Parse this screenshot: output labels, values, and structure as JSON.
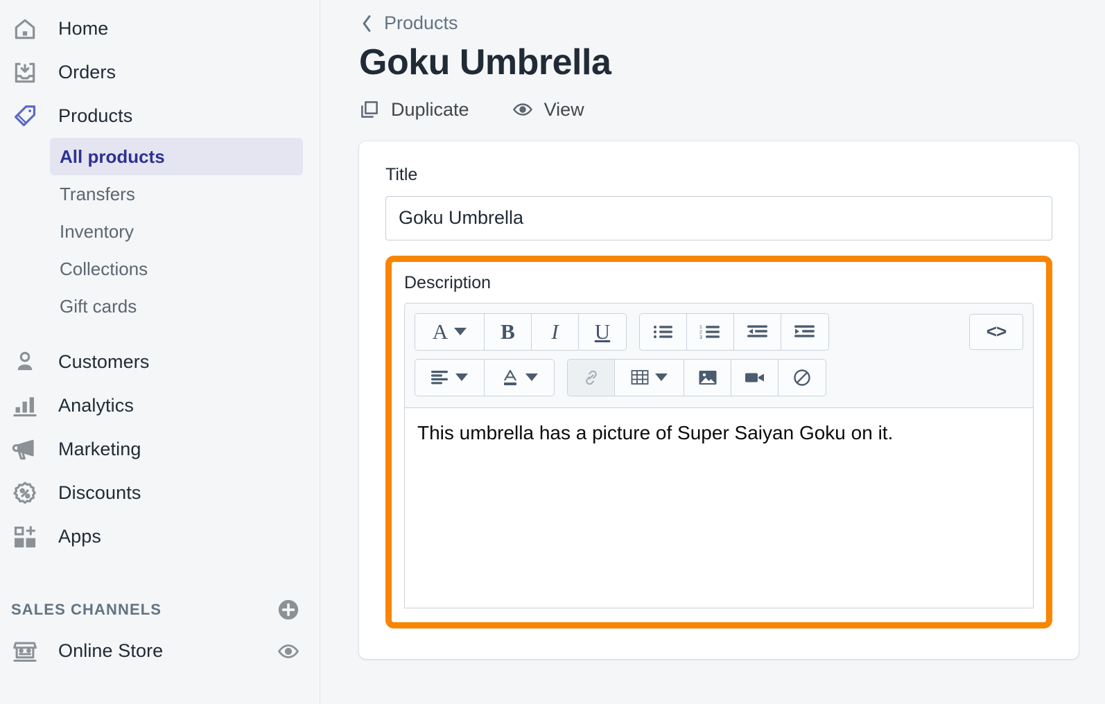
{
  "sidebar": {
    "items": [
      {
        "label": "Home",
        "icon": "home-icon"
      },
      {
        "label": "Orders",
        "icon": "orders-inbox-icon"
      },
      {
        "label": "Products",
        "icon": "products-tag-icon"
      }
    ],
    "product_subitems": [
      {
        "label": "All products",
        "active": true
      },
      {
        "label": "Transfers",
        "active": false
      },
      {
        "label": "Inventory",
        "active": false
      },
      {
        "label": "Collections",
        "active": false
      },
      {
        "label": "Gift cards",
        "active": false
      }
    ],
    "items2": [
      {
        "label": "Customers",
        "icon": "customer-person-icon"
      },
      {
        "label": "Analytics",
        "icon": "analytics-bar-chart-icon"
      },
      {
        "label": "Marketing",
        "icon": "marketing-megaphone-icon"
      },
      {
        "label": "Discounts",
        "icon": "discount-percent-badge-icon"
      },
      {
        "label": "Apps",
        "icon": "apps-grid-plus-icon"
      }
    ],
    "section": {
      "title": "SALES CHANNELS",
      "add_icon": "plus-circle-icon"
    },
    "channels": [
      {
        "label": "Online Store",
        "icon": "storefront-icon",
        "action_icon": "eye-icon"
      }
    ]
  },
  "header": {
    "breadcrumb": {
      "label": "Products",
      "icon": "chevron-left-icon"
    },
    "title": "Goku Umbrella",
    "actions": [
      {
        "label": "Duplicate",
        "icon": "duplicate-copy-icon"
      },
      {
        "label": "View",
        "icon": "eye-icon"
      }
    ]
  },
  "form": {
    "title_field": {
      "label": "Title",
      "value": "Goku Umbrella",
      "placeholder": ""
    },
    "description_field": {
      "label": "Description",
      "content": "This umbrella has a picture of Super Saiyan Goku on it.",
      "highlight_color": "#F98500"
    }
  },
  "editor_toolbar": {
    "row1": [
      {
        "name": "font-style-dropdown",
        "glyph": "A",
        "caret": true
      },
      {
        "name": "bold-button",
        "glyph": "B"
      },
      {
        "name": "italic-button",
        "glyph": "I"
      },
      {
        "name": "underline-button",
        "glyph": "U"
      },
      {
        "name": "bulleted-list-button",
        "icon": "bullet-list-icon"
      },
      {
        "name": "numbered-list-button",
        "icon": "numbered-list-icon"
      },
      {
        "name": "outdent-button",
        "icon": "outdent-icon"
      },
      {
        "name": "indent-button",
        "icon": "indent-icon"
      }
    ],
    "row2": [
      {
        "name": "align-dropdown",
        "icon": "align-left-icon",
        "caret": true
      },
      {
        "name": "text-color-dropdown",
        "icon": "text-color-icon",
        "caret": true
      },
      {
        "name": "insert-link-button",
        "icon": "link-icon",
        "pressed": true
      },
      {
        "name": "insert-table-dropdown",
        "icon": "table-icon",
        "caret": true
      },
      {
        "name": "insert-image-button",
        "icon": "image-icon"
      },
      {
        "name": "insert-video-button",
        "icon": "video-camera-icon"
      },
      {
        "name": "clear-formatting-button",
        "icon": "circle-slash-icon"
      }
    ],
    "code_button": {
      "name": "html-code-button",
      "label": "<>"
    }
  },
  "colors": {
    "accent_blue": "#5C6AC4",
    "active_nav_bg": "#E4E5F0",
    "active_nav_text": "#2E3192",
    "highlight_orange": "#F98500",
    "icon_gray": "#8C9196",
    "page_bg": "#F4F6F8"
  }
}
